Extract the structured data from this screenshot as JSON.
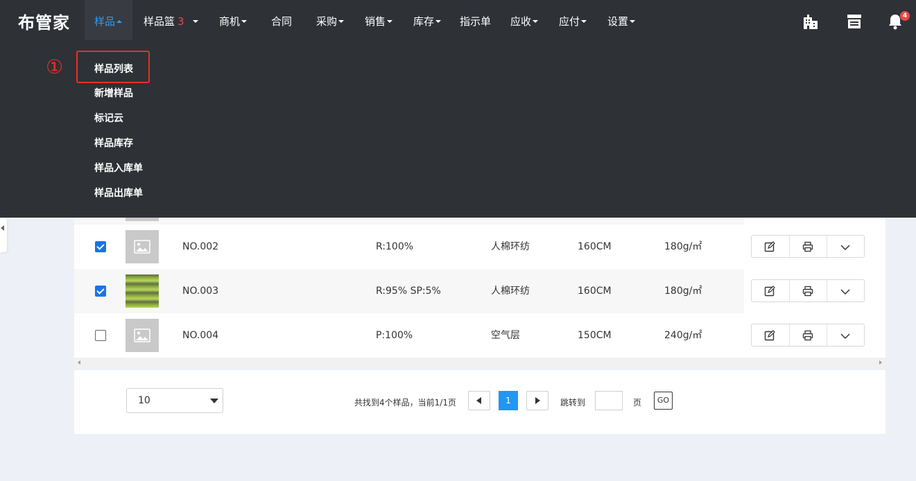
{
  "app": {
    "logo": "布管家"
  },
  "nav": {
    "samples": "样品",
    "cart": "样品篮",
    "cart_count": "3",
    "opportunity": "商机",
    "contract": "合同",
    "purchase": "采购",
    "sales": "销售",
    "inventory": "库存",
    "instruction": "指示单",
    "receivable": "应收",
    "payable": "应付",
    "settings": "设置",
    "bell_badge": "4"
  },
  "dropdown": {
    "step_marker": "①",
    "items": [
      "样品列表",
      "新增样品",
      "标记云",
      "样品库存",
      "样品入库单",
      "样品出库单"
    ]
  },
  "table": {
    "rows": [
      {
        "checked": true,
        "image": "placeholder",
        "code": "NO.002",
        "composition": "R:100%",
        "weave": "人棉环纺",
        "width": "160CM",
        "weight": "180g/㎡"
      },
      {
        "checked": true,
        "image": "photo",
        "code": "NO.003",
        "composition": "R:95% SP:5%",
        "weave": "人棉环纺",
        "width": "160CM",
        "weight": "180g/㎡"
      },
      {
        "checked": false,
        "image": "placeholder",
        "code": "NO.004",
        "composition": "P:100%",
        "weave": "空气层",
        "width": "150CM",
        "weight": "240g/㎡"
      }
    ]
  },
  "pagination": {
    "page_size": "10",
    "summary": "共找到4个样品，当前1/1页",
    "current_page": "1",
    "jump_label": "跳转到",
    "page_unit": "页",
    "go": "GO"
  },
  "icons": {
    "top_right": [
      "building-icon",
      "store-icon",
      "bell-icon"
    ],
    "row_actions": [
      "edit-icon",
      "print-icon",
      "chevron-down-icon"
    ]
  },
  "colors": {
    "nav_bg": "#2e3136",
    "accent": "#3b99e6",
    "badge": "#e84a4a",
    "highlight": "#e8302a",
    "page_bg": "#eef0f7"
  }
}
